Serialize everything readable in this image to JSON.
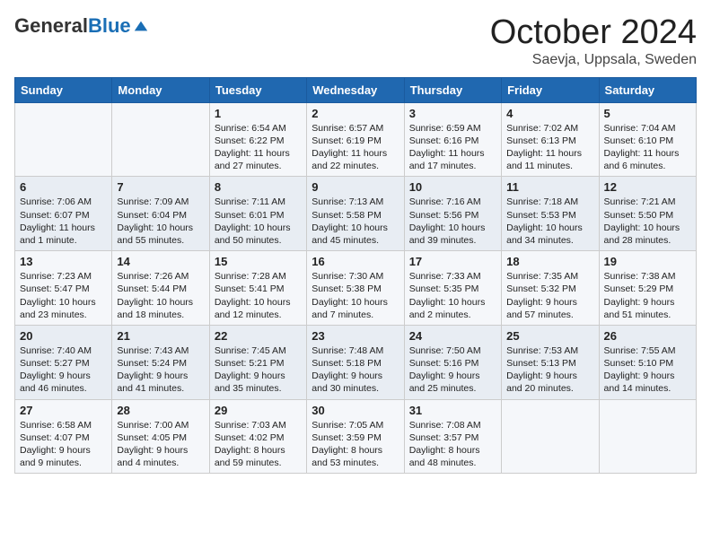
{
  "logo": {
    "general": "General",
    "blue": "Blue"
  },
  "title": "October 2024",
  "subtitle": "Saevja, Uppsala, Sweden",
  "headers": [
    "Sunday",
    "Monday",
    "Tuesday",
    "Wednesday",
    "Thursday",
    "Friday",
    "Saturday"
  ],
  "weeks": [
    [
      {
        "day": "",
        "lines": []
      },
      {
        "day": "",
        "lines": []
      },
      {
        "day": "1",
        "lines": [
          "Sunrise: 6:54 AM",
          "Sunset: 6:22 PM",
          "Daylight: 11 hours",
          "and 27 minutes."
        ]
      },
      {
        "day": "2",
        "lines": [
          "Sunrise: 6:57 AM",
          "Sunset: 6:19 PM",
          "Daylight: 11 hours",
          "and 22 minutes."
        ]
      },
      {
        "day": "3",
        "lines": [
          "Sunrise: 6:59 AM",
          "Sunset: 6:16 PM",
          "Daylight: 11 hours",
          "and 17 minutes."
        ]
      },
      {
        "day": "4",
        "lines": [
          "Sunrise: 7:02 AM",
          "Sunset: 6:13 PM",
          "Daylight: 11 hours",
          "and 11 minutes."
        ]
      },
      {
        "day": "5",
        "lines": [
          "Sunrise: 7:04 AM",
          "Sunset: 6:10 PM",
          "Daylight: 11 hours",
          "and 6 minutes."
        ]
      }
    ],
    [
      {
        "day": "6",
        "lines": [
          "Sunrise: 7:06 AM",
          "Sunset: 6:07 PM",
          "Daylight: 11 hours",
          "and 1 minute."
        ]
      },
      {
        "day": "7",
        "lines": [
          "Sunrise: 7:09 AM",
          "Sunset: 6:04 PM",
          "Daylight: 10 hours",
          "and 55 minutes."
        ]
      },
      {
        "day": "8",
        "lines": [
          "Sunrise: 7:11 AM",
          "Sunset: 6:01 PM",
          "Daylight: 10 hours",
          "and 50 minutes."
        ]
      },
      {
        "day": "9",
        "lines": [
          "Sunrise: 7:13 AM",
          "Sunset: 5:58 PM",
          "Daylight: 10 hours",
          "and 45 minutes."
        ]
      },
      {
        "day": "10",
        "lines": [
          "Sunrise: 7:16 AM",
          "Sunset: 5:56 PM",
          "Daylight: 10 hours",
          "and 39 minutes."
        ]
      },
      {
        "day": "11",
        "lines": [
          "Sunrise: 7:18 AM",
          "Sunset: 5:53 PM",
          "Daylight: 10 hours",
          "and 34 minutes."
        ]
      },
      {
        "day": "12",
        "lines": [
          "Sunrise: 7:21 AM",
          "Sunset: 5:50 PM",
          "Daylight: 10 hours",
          "and 28 minutes."
        ]
      }
    ],
    [
      {
        "day": "13",
        "lines": [
          "Sunrise: 7:23 AM",
          "Sunset: 5:47 PM",
          "Daylight: 10 hours",
          "and 23 minutes."
        ]
      },
      {
        "day": "14",
        "lines": [
          "Sunrise: 7:26 AM",
          "Sunset: 5:44 PM",
          "Daylight: 10 hours",
          "and 18 minutes."
        ]
      },
      {
        "day": "15",
        "lines": [
          "Sunrise: 7:28 AM",
          "Sunset: 5:41 PM",
          "Daylight: 10 hours",
          "and 12 minutes."
        ]
      },
      {
        "day": "16",
        "lines": [
          "Sunrise: 7:30 AM",
          "Sunset: 5:38 PM",
          "Daylight: 10 hours",
          "and 7 minutes."
        ]
      },
      {
        "day": "17",
        "lines": [
          "Sunrise: 7:33 AM",
          "Sunset: 5:35 PM",
          "Daylight: 10 hours",
          "and 2 minutes."
        ]
      },
      {
        "day": "18",
        "lines": [
          "Sunrise: 7:35 AM",
          "Sunset: 5:32 PM",
          "Daylight: 9 hours",
          "and 57 minutes."
        ]
      },
      {
        "day": "19",
        "lines": [
          "Sunrise: 7:38 AM",
          "Sunset: 5:29 PM",
          "Daylight: 9 hours",
          "and 51 minutes."
        ]
      }
    ],
    [
      {
        "day": "20",
        "lines": [
          "Sunrise: 7:40 AM",
          "Sunset: 5:27 PM",
          "Daylight: 9 hours",
          "and 46 minutes."
        ]
      },
      {
        "day": "21",
        "lines": [
          "Sunrise: 7:43 AM",
          "Sunset: 5:24 PM",
          "Daylight: 9 hours",
          "and 41 minutes."
        ]
      },
      {
        "day": "22",
        "lines": [
          "Sunrise: 7:45 AM",
          "Sunset: 5:21 PM",
          "Daylight: 9 hours",
          "and 35 minutes."
        ]
      },
      {
        "day": "23",
        "lines": [
          "Sunrise: 7:48 AM",
          "Sunset: 5:18 PM",
          "Daylight: 9 hours",
          "and 30 minutes."
        ]
      },
      {
        "day": "24",
        "lines": [
          "Sunrise: 7:50 AM",
          "Sunset: 5:16 PM",
          "Daylight: 9 hours",
          "and 25 minutes."
        ]
      },
      {
        "day": "25",
        "lines": [
          "Sunrise: 7:53 AM",
          "Sunset: 5:13 PM",
          "Daylight: 9 hours",
          "and 20 minutes."
        ]
      },
      {
        "day": "26",
        "lines": [
          "Sunrise: 7:55 AM",
          "Sunset: 5:10 PM",
          "Daylight: 9 hours",
          "and 14 minutes."
        ]
      }
    ],
    [
      {
        "day": "27",
        "lines": [
          "Sunrise: 6:58 AM",
          "Sunset: 4:07 PM",
          "Daylight: 9 hours",
          "and 9 minutes."
        ]
      },
      {
        "day": "28",
        "lines": [
          "Sunrise: 7:00 AM",
          "Sunset: 4:05 PM",
          "Daylight: 9 hours",
          "and 4 minutes."
        ]
      },
      {
        "day": "29",
        "lines": [
          "Sunrise: 7:03 AM",
          "Sunset: 4:02 PM",
          "Daylight: 8 hours",
          "and 59 minutes."
        ]
      },
      {
        "day": "30",
        "lines": [
          "Sunrise: 7:05 AM",
          "Sunset: 3:59 PM",
          "Daylight: 8 hours",
          "and 53 minutes."
        ]
      },
      {
        "day": "31",
        "lines": [
          "Sunrise: 7:08 AM",
          "Sunset: 3:57 PM",
          "Daylight: 8 hours",
          "and 48 minutes."
        ]
      },
      {
        "day": "",
        "lines": []
      },
      {
        "day": "",
        "lines": []
      }
    ]
  ]
}
